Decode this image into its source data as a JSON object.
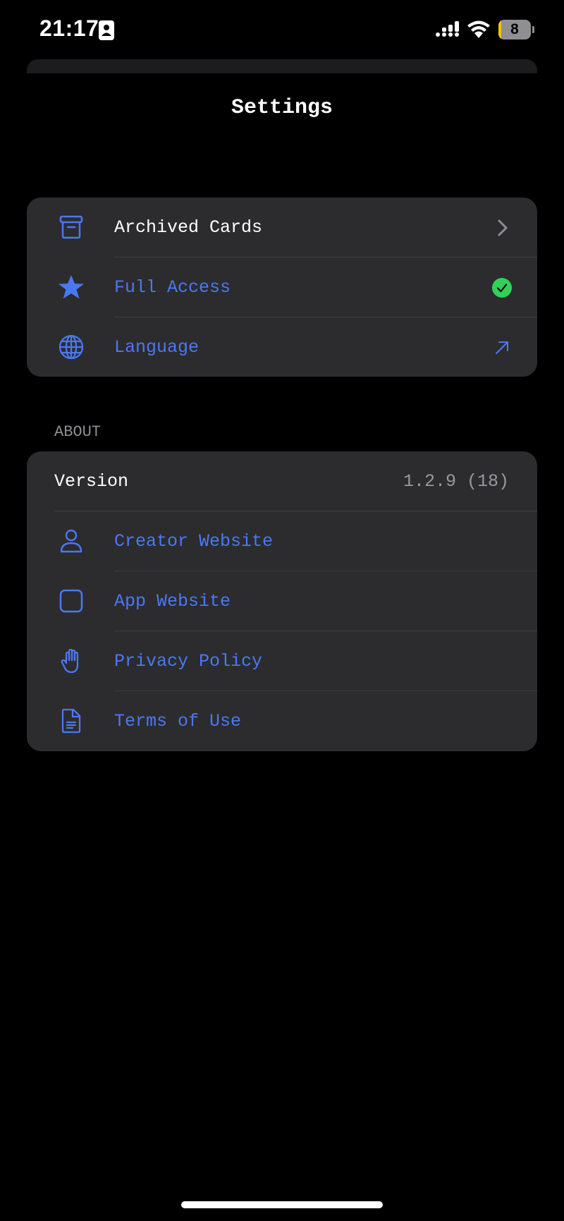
{
  "status_bar": {
    "time": "21:17",
    "battery_level": "8",
    "battery_fraction": 0.08
  },
  "title": "Settings",
  "main_section": {
    "items": [
      {
        "label": "Archived Cards",
        "icon": "archive-box-icon",
        "accessory": "chevron-right-icon"
      },
      {
        "label": "Full Access",
        "icon": "star-icon",
        "accessory": "checkmark-circle-icon"
      },
      {
        "label": "Language",
        "icon": "globe-icon",
        "accessory": "arrow-up-right-icon"
      }
    ]
  },
  "about_section": {
    "header": "ABOUT",
    "version_label": "Version",
    "version_value": "1.2.9 (18)",
    "items": [
      {
        "label": "Creator Website",
        "icon": "person-icon"
      },
      {
        "label": "App Website",
        "icon": "square-icon"
      },
      {
        "label": "Privacy Policy",
        "icon": "hand-raised-icon"
      },
      {
        "label": "Terms of Use",
        "icon": "document-icon"
      }
    ]
  },
  "colors": {
    "background": "#000000",
    "card": "#2c2c2e",
    "accent": "#4a78f5",
    "success": "#30d158",
    "secondary_text": "#8e8e93"
  }
}
